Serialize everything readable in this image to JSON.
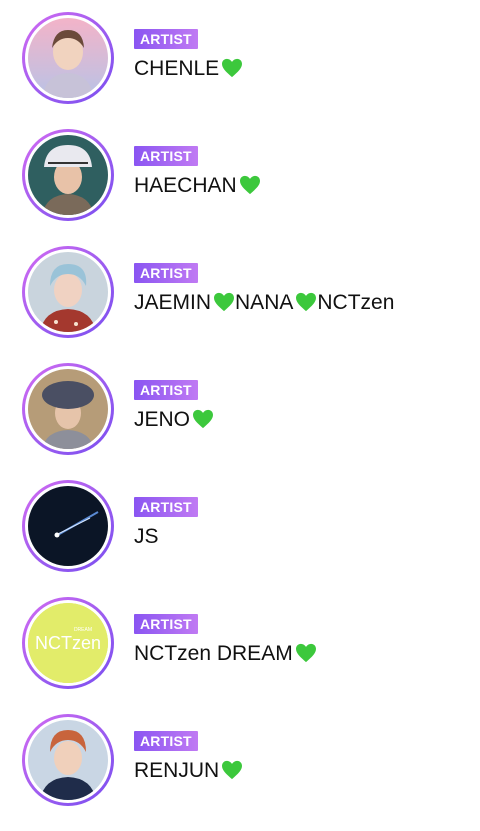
{
  "items": [
    {
      "badge": "ARTIST",
      "name": "CHENLE💚",
      "avatar": "person-avatar-pink-background"
    },
    {
      "badge": "ARTIST",
      "name": "HAECHAN💚",
      "avatar": "person-avatar-bucket-hat"
    },
    {
      "badge": "ARTIST",
      "name": "JAEMIN💚NANA💚NCTzen",
      "avatar": "person-avatar-blue-hair"
    },
    {
      "badge": "ARTIST",
      "name": "JENO💚",
      "avatar": "person-avatar-beret"
    },
    {
      "badge": "ARTIST",
      "name": "JS",
      "avatar": "shooting-star-avatar"
    },
    {
      "badge": "ARTIST",
      "name": "NCTzen DREAM💚",
      "avatar": "nctzen-logo-avatar"
    },
    {
      "badge": "ARTIST",
      "name": "RENJUN💚",
      "avatar": "person-avatar-red-hair"
    }
  ],
  "logo_text": {
    "main": "NCTzen",
    "small": "DREAM"
  },
  "colors": {
    "badge_start": "#8a55f2",
    "badge_end": "#c07af3",
    "ring": "#9b5cf0",
    "heart": "#3cc83c",
    "logo_bg": "#e2ec6a"
  }
}
